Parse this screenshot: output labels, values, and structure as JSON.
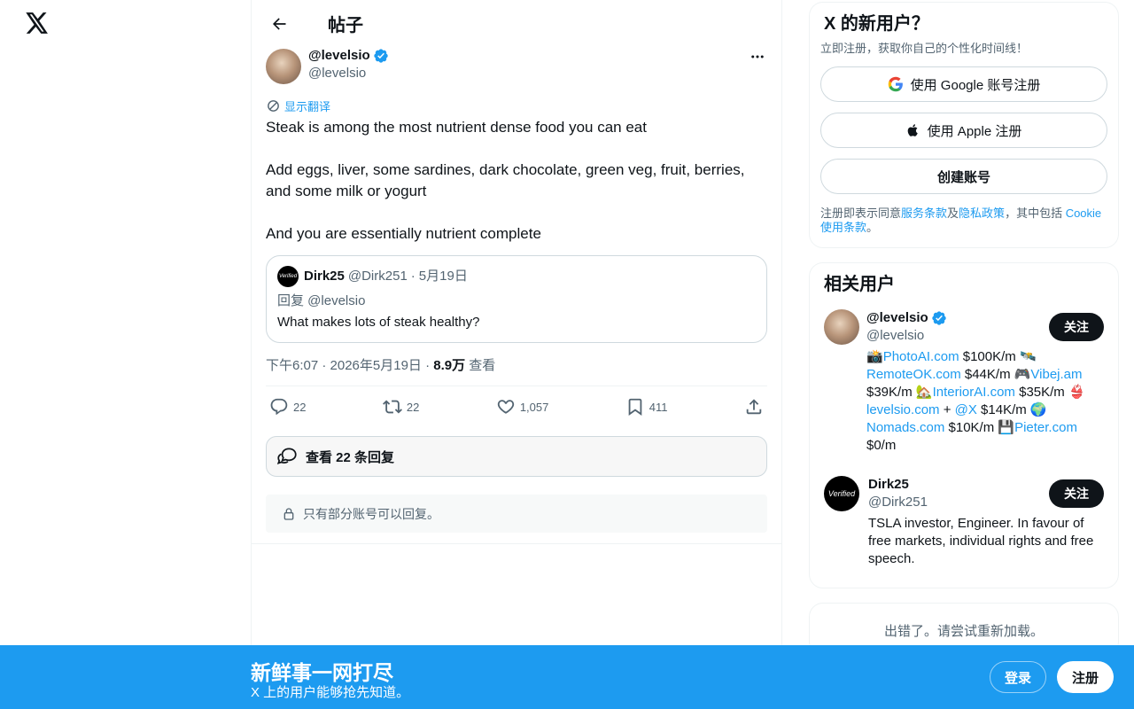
{
  "app": {
    "logo": "x-logo"
  },
  "header": {
    "title": "帖子",
    "back_icon": "arrow-left-icon"
  },
  "post": {
    "author_name": "@levelsio",
    "author_handle": "@levelsio",
    "verified_icon": "verified-badge-icon",
    "more_icon": "ellipsis-icon",
    "translate_label": "显示翻译",
    "text": "Steak is among the most nutrient dense food you can eat\n\nAdd eggs, liver, some sardines, dark chocolate, green veg, fruit, berries, and some milk or yogurt\n\nAnd you are essentially nutrient complete",
    "quote": {
      "avatar_text": "Verified",
      "name": "Dirk25",
      "handle": "@Dirk251",
      "date": "5月19日",
      "reply_to": "回复 @levelsio",
      "text": "What makes lots of steak healthy?"
    },
    "timestamp": "下午6:07 · 2026年5月19日 · ",
    "views_count": "8.9万",
    "views_label": "查看",
    "stats": {
      "replies": "22",
      "reposts": "22",
      "likes": "1,057",
      "bookmarks": "411"
    },
    "view_replies_label": "查看 22 条回复",
    "restricted_notice": "只有部分账号可以回复。"
  },
  "signup_card": {
    "title": "X 的新用户？",
    "subtitle": "立即注册，获取你自己的个性化时间线！",
    "google_label": "使用 Google 账号注册",
    "apple_label": "使用 Apple 注册",
    "create_label": "创建账号",
    "terms_prefix": "注册即表示同意",
    "terms_link": "服务条款",
    "terms_and": "及",
    "privacy_link": "隐私政策",
    "terms_mid": "，其中包括 ",
    "cookie_link": "Cookie 使用条款",
    "terms_end": "。"
  },
  "related": {
    "title": "相关用户",
    "users": [
      {
        "name": "@levelsio",
        "handle": "@levelsio",
        "follow_label": "关注"
      },
      {
        "name": "Dirk25",
        "handle": "@Dirk251",
        "bio": "TSLA investor, Engineer. In favour of free markets, individual rights and free speech.",
        "avatar_text": "Verified",
        "follow_label": "关注"
      }
    ],
    "levelsio_bio": {
      "e1": "📸",
      "l1": "PhotoAI.com",
      "t1": " $100K/m ",
      "e2": "🛰️",
      "l2": "RemoteOK.com",
      "t2": " $44K/m ",
      "e3": "🎮",
      "l3": "Vibej.am",
      "t3": " $39K/m ",
      "e4": "🏡",
      "l4": "InteriorAI.com",
      "t4": " $35K/m ",
      "e5": "👙",
      "l5": "levelsio.com",
      "t5": " + ",
      "l6": "@X",
      "t6": " $14K/m ",
      "e7": "🌍",
      "l7": "Nomads.com",
      "t7": " $10K/m ",
      "e8": "💾",
      "l8": "Pieter.com",
      "t8": " $0/m"
    }
  },
  "error": {
    "text": "出错了。请尝试重新加载。"
  },
  "bottom_bar": {
    "title": "新鲜事一网打尽",
    "subtitle": "X 上的用户能够抢先知道。",
    "login_label": "登录",
    "signup_label": "注册"
  },
  "colors": {
    "accent": "#1d9bf0",
    "text": "#0f1419",
    "secondary": "#536471"
  }
}
